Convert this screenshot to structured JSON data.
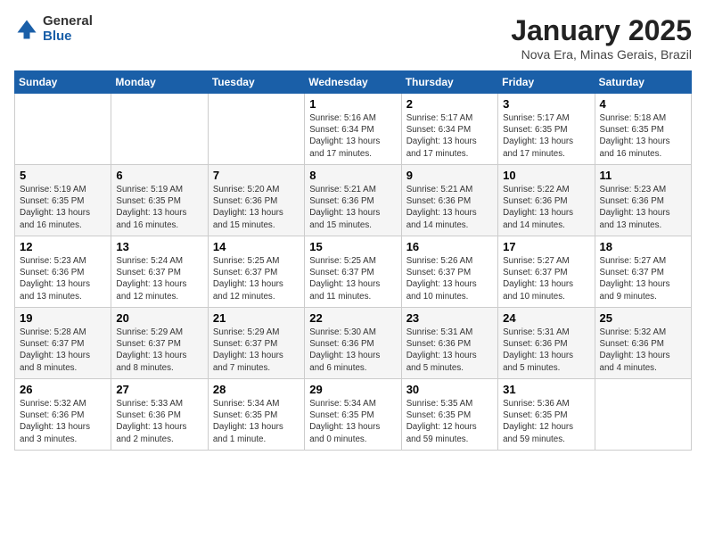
{
  "header": {
    "logo_general": "General",
    "logo_blue": "Blue",
    "month": "January 2025",
    "location": "Nova Era, Minas Gerais, Brazil"
  },
  "days_of_week": [
    "Sunday",
    "Monday",
    "Tuesday",
    "Wednesday",
    "Thursday",
    "Friday",
    "Saturday"
  ],
  "weeks": [
    [
      {
        "day": "",
        "info": ""
      },
      {
        "day": "",
        "info": ""
      },
      {
        "day": "",
        "info": ""
      },
      {
        "day": "1",
        "info": "Sunrise: 5:16 AM\nSunset: 6:34 PM\nDaylight: 13 hours and 17 minutes."
      },
      {
        "day": "2",
        "info": "Sunrise: 5:17 AM\nSunset: 6:34 PM\nDaylight: 13 hours and 17 minutes."
      },
      {
        "day": "3",
        "info": "Sunrise: 5:17 AM\nSunset: 6:35 PM\nDaylight: 13 hours and 17 minutes."
      },
      {
        "day": "4",
        "info": "Sunrise: 5:18 AM\nSunset: 6:35 PM\nDaylight: 13 hours and 16 minutes."
      }
    ],
    [
      {
        "day": "5",
        "info": "Sunrise: 5:19 AM\nSunset: 6:35 PM\nDaylight: 13 hours and 16 minutes."
      },
      {
        "day": "6",
        "info": "Sunrise: 5:19 AM\nSunset: 6:35 PM\nDaylight: 13 hours and 16 minutes."
      },
      {
        "day": "7",
        "info": "Sunrise: 5:20 AM\nSunset: 6:36 PM\nDaylight: 13 hours and 15 minutes."
      },
      {
        "day": "8",
        "info": "Sunrise: 5:21 AM\nSunset: 6:36 PM\nDaylight: 13 hours and 15 minutes."
      },
      {
        "day": "9",
        "info": "Sunrise: 5:21 AM\nSunset: 6:36 PM\nDaylight: 13 hours and 14 minutes."
      },
      {
        "day": "10",
        "info": "Sunrise: 5:22 AM\nSunset: 6:36 PM\nDaylight: 13 hours and 14 minutes."
      },
      {
        "day": "11",
        "info": "Sunrise: 5:23 AM\nSunset: 6:36 PM\nDaylight: 13 hours and 13 minutes."
      }
    ],
    [
      {
        "day": "12",
        "info": "Sunrise: 5:23 AM\nSunset: 6:36 PM\nDaylight: 13 hours and 13 minutes."
      },
      {
        "day": "13",
        "info": "Sunrise: 5:24 AM\nSunset: 6:37 PM\nDaylight: 13 hours and 12 minutes."
      },
      {
        "day": "14",
        "info": "Sunrise: 5:25 AM\nSunset: 6:37 PM\nDaylight: 13 hours and 12 minutes."
      },
      {
        "day": "15",
        "info": "Sunrise: 5:25 AM\nSunset: 6:37 PM\nDaylight: 13 hours and 11 minutes."
      },
      {
        "day": "16",
        "info": "Sunrise: 5:26 AM\nSunset: 6:37 PM\nDaylight: 13 hours and 10 minutes."
      },
      {
        "day": "17",
        "info": "Sunrise: 5:27 AM\nSunset: 6:37 PM\nDaylight: 13 hours and 10 minutes."
      },
      {
        "day": "18",
        "info": "Sunrise: 5:27 AM\nSunset: 6:37 PM\nDaylight: 13 hours and 9 minutes."
      }
    ],
    [
      {
        "day": "19",
        "info": "Sunrise: 5:28 AM\nSunset: 6:37 PM\nDaylight: 13 hours and 8 minutes."
      },
      {
        "day": "20",
        "info": "Sunrise: 5:29 AM\nSunset: 6:37 PM\nDaylight: 13 hours and 8 minutes."
      },
      {
        "day": "21",
        "info": "Sunrise: 5:29 AM\nSunset: 6:37 PM\nDaylight: 13 hours and 7 minutes."
      },
      {
        "day": "22",
        "info": "Sunrise: 5:30 AM\nSunset: 6:36 PM\nDaylight: 13 hours and 6 minutes."
      },
      {
        "day": "23",
        "info": "Sunrise: 5:31 AM\nSunset: 6:36 PM\nDaylight: 13 hours and 5 minutes."
      },
      {
        "day": "24",
        "info": "Sunrise: 5:31 AM\nSunset: 6:36 PM\nDaylight: 13 hours and 5 minutes."
      },
      {
        "day": "25",
        "info": "Sunrise: 5:32 AM\nSunset: 6:36 PM\nDaylight: 13 hours and 4 minutes."
      }
    ],
    [
      {
        "day": "26",
        "info": "Sunrise: 5:32 AM\nSunset: 6:36 PM\nDaylight: 13 hours and 3 minutes."
      },
      {
        "day": "27",
        "info": "Sunrise: 5:33 AM\nSunset: 6:36 PM\nDaylight: 13 hours and 2 minutes."
      },
      {
        "day": "28",
        "info": "Sunrise: 5:34 AM\nSunset: 6:35 PM\nDaylight: 13 hours and 1 minute."
      },
      {
        "day": "29",
        "info": "Sunrise: 5:34 AM\nSunset: 6:35 PM\nDaylight: 13 hours and 0 minutes."
      },
      {
        "day": "30",
        "info": "Sunrise: 5:35 AM\nSunset: 6:35 PM\nDaylight: 12 hours and 59 minutes."
      },
      {
        "day": "31",
        "info": "Sunrise: 5:36 AM\nSunset: 6:35 PM\nDaylight: 12 hours and 59 minutes."
      },
      {
        "day": "",
        "info": ""
      }
    ]
  ]
}
